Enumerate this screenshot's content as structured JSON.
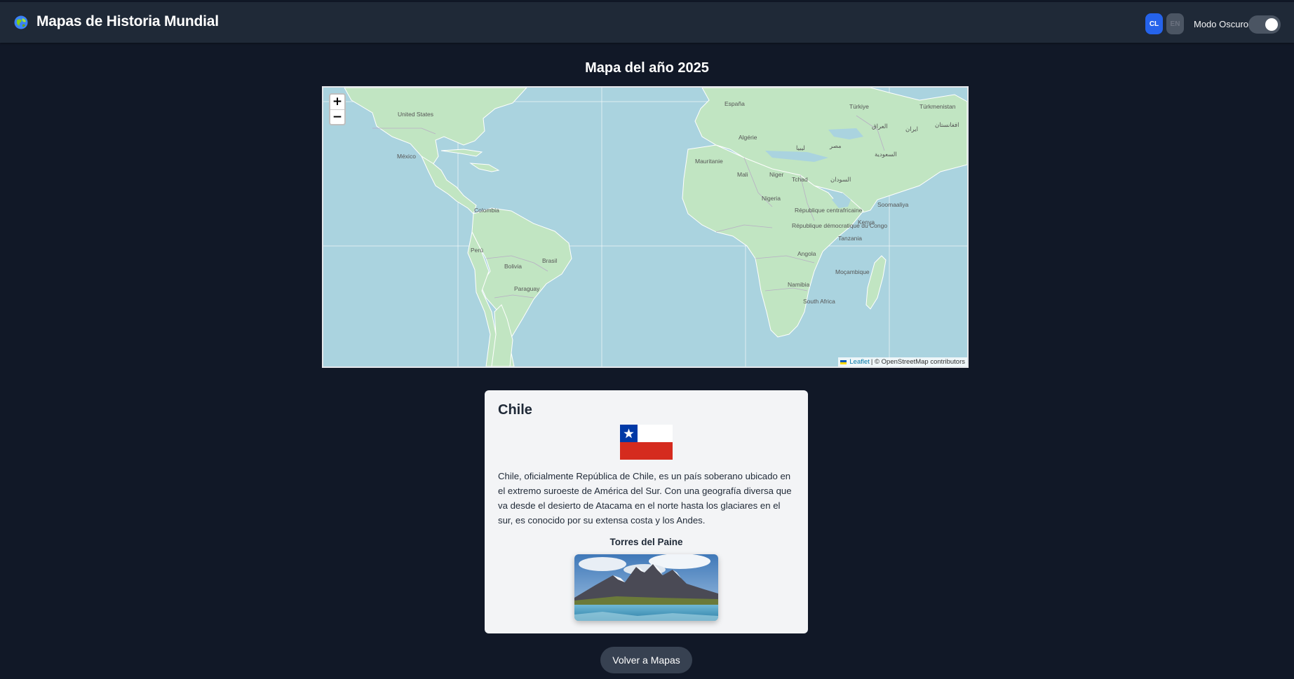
{
  "header": {
    "title": "Mapas de Historia Mundial",
    "lang_active": "CL",
    "lang_other": "EN",
    "dark_mode_label": "Modo Oscuro",
    "dark_mode_on": true
  },
  "map": {
    "heading": "Mapa del año 2025",
    "zoom_in": "+",
    "zoom_out": "−",
    "attribution_link": "Leaflet",
    "attribution_text": "| © OpenStreetMap contributors",
    "labels": {
      "us": "United States",
      "mx": "México",
      "co": "Colombia",
      "pe": "Perú",
      "bo": "Bolivia",
      "br": "Brasil",
      "py": "Paraguay",
      "es": "España",
      "tr": "Türkiye",
      "tm": "Türkmenistan",
      "dz": "Algérie",
      "ly": "ليبيا",
      "eg": "مصر",
      "iq": "العراق",
      "ir": "ایران",
      "af": "افغانستان",
      "sa": "السعودية",
      "ml": "Mali",
      "mr": "Mauritanie",
      "ne": "Niger",
      "td": "Tchad",
      "sd": "السودان",
      "ng": "Nigeria",
      "so": "Soomaaliya",
      "ke": "Kenya",
      "cd": "République démocratique du Congo",
      "cf": "République centrafricaine",
      "tz": "Tanzania",
      "ao": "Angola",
      "mz": "Moçambique",
      "na": "Namibia",
      "za": "South Africa"
    }
  },
  "country": {
    "name": "Chile",
    "description": "Chile, oficialmente República de Chile, es un país soberano ubicado en el extremo suroeste de América del Sur. Con una geografía diversa que va desde el desierto de Atacama en el norte hasta los glaciares en el sur, es conocido por su extensa costa y los Andes.",
    "landmark_title": "Torres del Paine"
  },
  "back_button": "Volver a Mapas",
  "colors": {
    "background": "#111827",
    "header": "#1f2937",
    "accent": "#2563eb",
    "ocean": "#aad3df",
    "land": "#c1e5c2",
    "card": "#f3f4f6"
  }
}
